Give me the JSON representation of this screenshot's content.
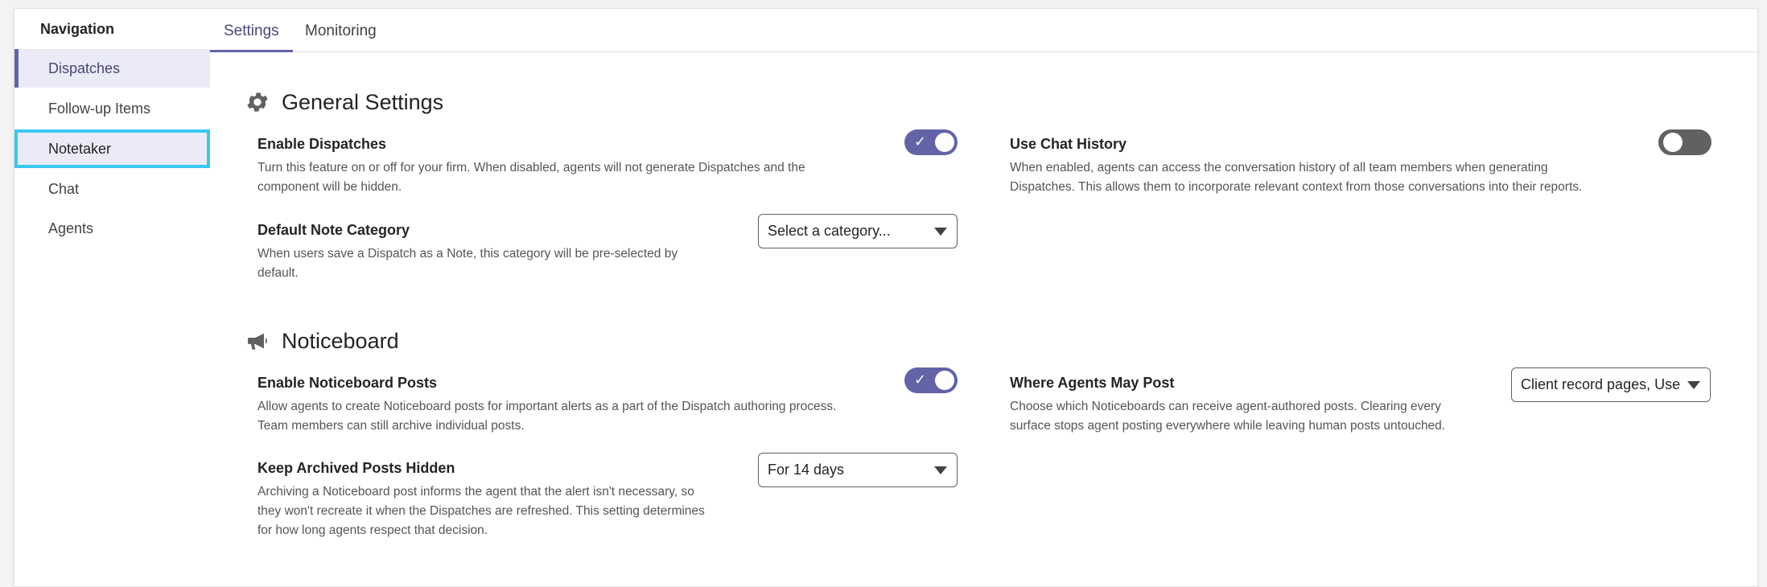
{
  "sidebar": {
    "title": "Navigation",
    "items": [
      {
        "label": "Dispatches"
      },
      {
        "label": "Follow-up Items"
      },
      {
        "label": "Notetaker"
      },
      {
        "label": "Chat"
      },
      {
        "label": "Agents"
      }
    ]
  },
  "tabs": [
    {
      "label": "Settings"
    },
    {
      "label": "Monitoring"
    }
  ],
  "general": {
    "title": "General Settings",
    "icon": "gear-icon",
    "enable_dispatches": {
      "label": "Enable Dispatches",
      "desc1": "Turn this feature on or off for your firm. When disabled, agents will not generate Dispatches and the",
      "desc2": "component will be hidden.",
      "state": "on"
    },
    "use_chat_history": {
      "label": "Use Chat History",
      "desc1": "When enabled, agents can access the conversation history of all team members when generating",
      "desc2": "Dispatches. This allows them to incorporate relevant context from those conversations into their reports.",
      "state": "off"
    },
    "default_note_category": {
      "label": "Default Note Category",
      "desc1": "When users save a Dispatch as a Note, this category will be pre-selected by",
      "desc2": "default.",
      "placeholder": "Select a category..."
    }
  },
  "noticeboard": {
    "title": "Noticeboard",
    "icon": "megaphone-icon",
    "enable_posts": {
      "label": "Enable Noticeboard Posts",
      "desc1": "Allow agents to create Noticeboard posts for important alerts as a part of the Dispatch authoring process.",
      "desc2": "Team members can still archive individual posts.",
      "state": "on"
    },
    "where_agents_may_post": {
      "label": "Where Agents May Post",
      "desc1": "Choose which Noticeboards can receive agent-authored posts. Clearing every",
      "desc2": "surface stops agent posting everywhere while leaving human posts untouched.",
      "value": "Client record pages, Use"
    },
    "keep_archived_hidden": {
      "label": "Keep Archived Posts Hidden",
      "desc1": "Archiving a Noticeboard post informs the agent that the alert isn't necessary, so",
      "desc2": "they won't recreate it when the Dispatches are refreshed. This setting determines",
      "desc3": "for how long agents respect that decision.",
      "value": "For 14 days"
    }
  },
  "colors": {
    "accent": "#6264a7",
    "focus_ring": "#3bc8f0",
    "toggle_off": "#616161"
  }
}
